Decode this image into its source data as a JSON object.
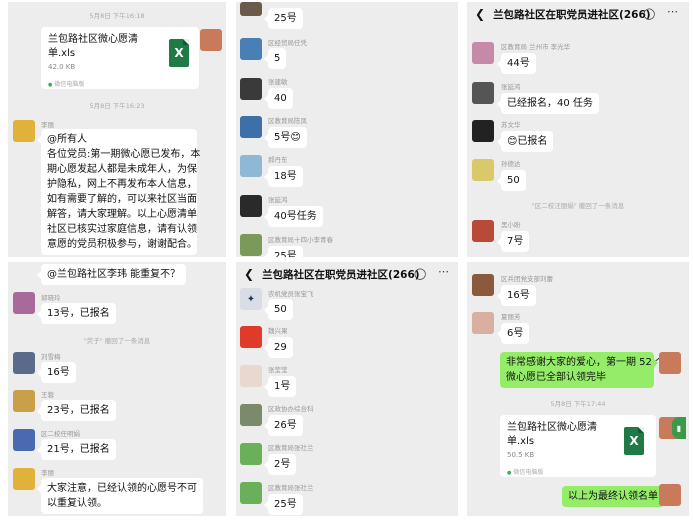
{
  "panel1": {
    "time1": "5月8日 下午16:18",
    "file": {
      "name": "兰包路社区微心愿清单.xls",
      "size": "42.0 KB",
      "source": "微信电脑版"
    },
    "time2": "5月8日 下午16:23",
    "nick": "李丽",
    "announcement": [
      "@所有人",
      "各位党员:第一期微心愿已发布，本",
      "期心愿发起人都是未成年人，为保",
      "护隐私，网上不再发布本人信息，",
      "如有需要了解的，可以来社区当面",
      "解答，请大家理解。以上心愿清单",
      "社区已核实过家庭信息，请有认领",
      "意愿的党员积极参与，谢谢配合。"
    ]
  },
  "panel2": {
    "msgs": [
      {
        "nick": "",
        "text": "25号"
      },
      {
        "nick": "区经贸局任凭",
        "text": "5"
      },
      {
        "nick": "张建敏",
        "text": "40"
      },
      {
        "nick": "区教育局陈凤",
        "text": "5号😊"
      },
      {
        "nick": "郝丹东",
        "text": "18号"
      },
      {
        "nick": "张延鸿",
        "text": "40号任务"
      },
      {
        "nick": "区教育局十四小李青春",
        "text": "25号"
      }
    ]
  },
  "panel3": {
    "title": "兰包路社区在职党员进社区(266)",
    "msgs": [
      {
        "nick": "区教育局 兰州市 李光华",
        "text": "44号"
      },
      {
        "nick": "张延鸿",
        "text": "已经报名，40 任务"
      },
      {
        "nick": "苏文华",
        "text": "😊已报名"
      },
      {
        "nick": "孙德达",
        "text": "50"
      }
    ],
    "recall": "\"区二校汪丽娟\" 撤回了一条消息",
    "last": {
      "nick": "黑小盼",
      "text": "7号"
    }
  },
  "panel4": {
    "top": "@兰包路社区李玮  能重复不？",
    "msgs1": [
      {
        "nick": "郭晓玲",
        "text": "13号，已报名"
      }
    ],
    "recall": "\"荧子\" 撤回了一条消息",
    "msgs2": [
      {
        "nick": "刘雪梅",
        "text": "16号"
      },
      {
        "nick": "王蓉",
        "text": "23号，已报名"
      },
      {
        "nick": "区二校任明娟",
        "text": "21号，已报名"
      }
    ],
    "last": {
      "nick": "李丽",
      "lines": [
        "大家注意，已经认领的心愿号不可",
        "以重复认领。"
      ]
    }
  },
  "panel5": {
    "title": "兰包路社区在职党员进社区(266)",
    "msgs": [
      {
        "nick": "农机党员张宝飞",
        "text": "50"
      },
      {
        "nick": "魏兴果",
        "text": "29"
      },
      {
        "nick": "张莹莹",
        "text": "1号"
      },
      {
        "nick": "区政协办综合科",
        "text": "26号"
      },
      {
        "nick": "区教育局张社兰",
        "text": "2号"
      },
      {
        "nick": "区教育局张社兰",
        "text": "25号"
      }
    ]
  },
  "panel6": {
    "msgs": [
      {
        "nick": "区兵团党支部刘蕾",
        "text": "16号"
      },
      {
        "nick": "夏丽芳",
        "text": "6号"
      }
    ],
    "thanks": [
      "非常感谢大家的爱心，第一期 52 个",
      "微心愿已全部认领完毕"
    ],
    "time": "5月8日 下午17:44",
    "file": {
      "name": "兰包路社区微心愿清单.xls",
      "size": "50.5 KB",
      "source": "微信电脑版"
    },
    "final": "以上为最终认领名单"
  }
}
